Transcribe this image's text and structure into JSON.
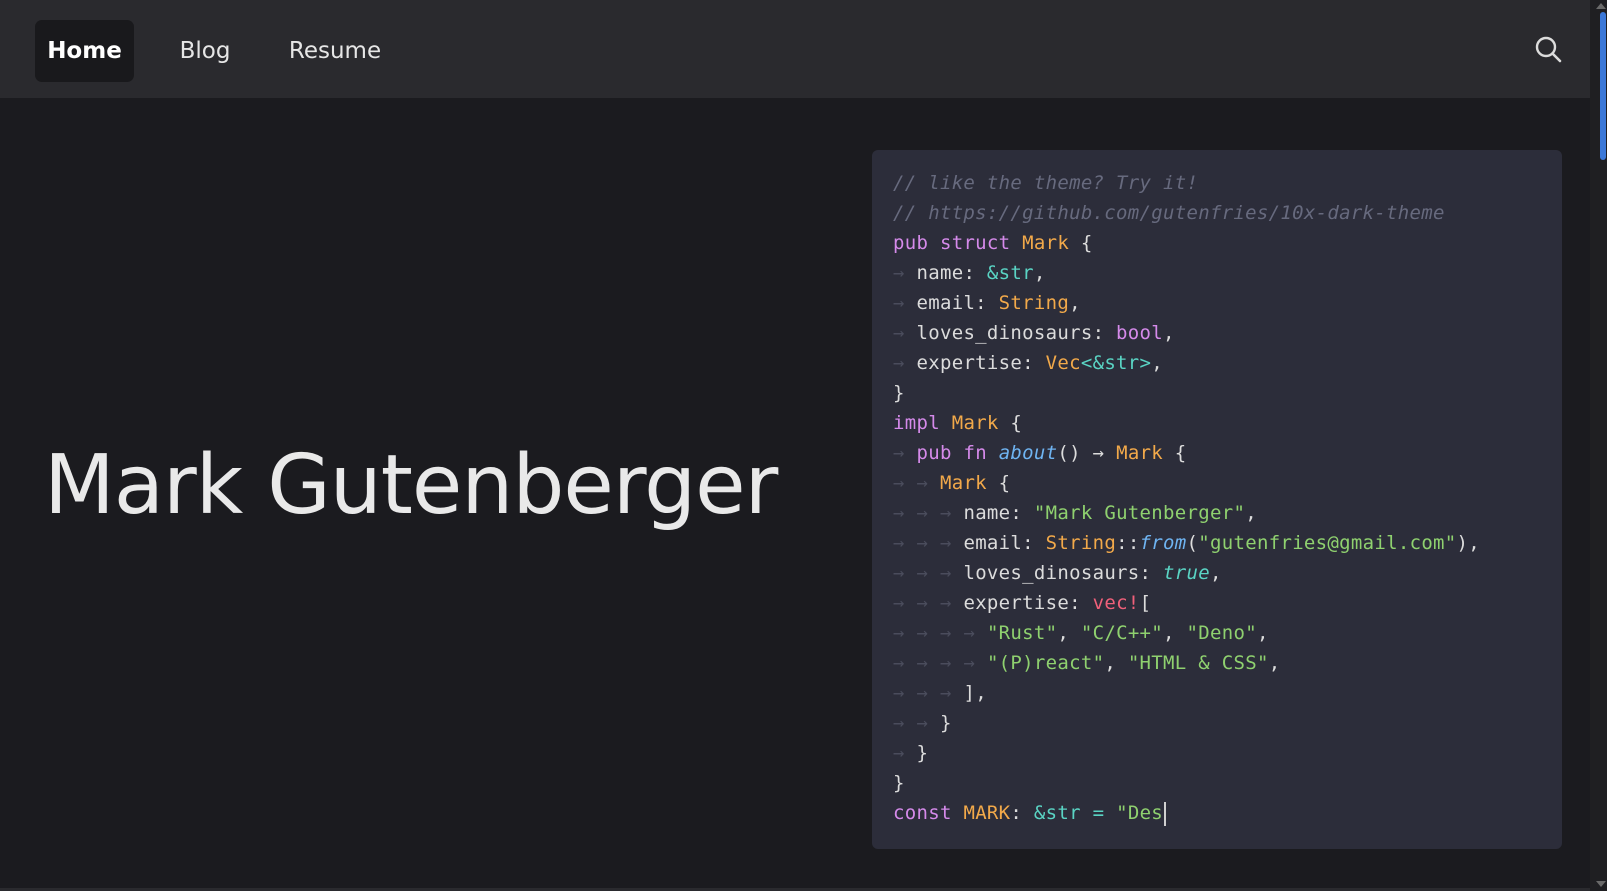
{
  "nav": {
    "items": [
      {
        "label": "Home",
        "active": true
      },
      {
        "label": "Blog",
        "active": false
      },
      {
        "label": "Resume",
        "active": false
      }
    ],
    "search_icon": "search-icon"
  },
  "hero": {
    "name": "Mark Gutenberger"
  },
  "code": {
    "lines": [
      {
        "indent": 0,
        "tokens": [
          {
            "t": "// like the theme? Try it!",
            "c": "comment"
          }
        ]
      },
      {
        "indent": 0,
        "tokens": [
          {
            "t": "// https://github.com/gutenfries/10x-dark-theme",
            "c": "comment"
          }
        ]
      },
      {
        "indent": 0,
        "tokens": [
          {
            "t": "pub",
            "c": "kw"
          },
          {
            "t": " ",
            "c": "plain"
          },
          {
            "t": "struct",
            "c": "kw"
          },
          {
            "t": " ",
            "c": "plain"
          },
          {
            "t": "Mark",
            "c": "type"
          },
          {
            "t": " {",
            "c": "plain"
          }
        ]
      },
      {
        "indent": 1,
        "tokens": [
          {
            "t": "name: ",
            "c": "plain"
          },
          {
            "t": "&str",
            "c": "ref"
          },
          {
            "t": ",",
            "c": "plain"
          }
        ]
      },
      {
        "indent": 1,
        "tokens": [
          {
            "t": "email: ",
            "c": "plain"
          },
          {
            "t": "String",
            "c": "type"
          },
          {
            "t": ",",
            "c": "plain"
          }
        ]
      },
      {
        "indent": 1,
        "tokens": [
          {
            "t": "loves_dinosaurs: ",
            "c": "plain"
          },
          {
            "t": "bool",
            "c": "kw"
          },
          {
            "t": ",",
            "c": "plain"
          }
        ]
      },
      {
        "indent": 1,
        "tokens": [
          {
            "t": "expertise: ",
            "c": "plain"
          },
          {
            "t": "Vec",
            "c": "type"
          },
          {
            "t": "<&str>",
            "c": "ref"
          },
          {
            "t": ",",
            "c": "plain"
          }
        ]
      },
      {
        "indent": 0,
        "tokens": [
          {
            "t": "}",
            "c": "plain"
          }
        ]
      },
      {
        "indent": 0,
        "tokens": [
          {
            "t": "impl",
            "c": "kw"
          },
          {
            "t": " ",
            "c": "plain"
          },
          {
            "t": "Mark",
            "c": "type"
          },
          {
            "t": " {",
            "c": "plain"
          }
        ]
      },
      {
        "indent": 1,
        "tokens": [
          {
            "t": "pub",
            "c": "kw"
          },
          {
            "t": " ",
            "c": "plain"
          },
          {
            "t": "fn",
            "c": "kw"
          },
          {
            "t": " ",
            "c": "plain"
          },
          {
            "t": "about",
            "c": "fn"
          },
          {
            "t": "() → ",
            "c": "plain"
          },
          {
            "t": "Mark",
            "c": "type"
          },
          {
            "t": " {",
            "c": "plain"
          }
        ]
      },
      {
        "indent": 2,
        "tokens": [
          {
            "t": "Mark",
            "c": "type"
          },
          {
            "t": " {",
            "c": "plain"
          }
        ]
      },
      {
        "indent": 3,
        "tokens": [
          {
            "t": "name: ",
            "c": "plain"
          },
          {
            "t": "\"Mark Gutenberger\"",
            "c": "str"
          },
          {
            "t": ",",
            "c": "plain"
          }
        ]
      },
      {
        "indent": 3,
        "tokens": [
          {
            "t": "email: ",
            "c": "plain"
          },
          {
            "t": "String",
            "c": "type"
          },
          {
            "t": "::",
            "c": "plain"
          },
          {
            "t": "from",
            "c": "fn"
          },
          {
            "t": "(",
            "c": "plain"
          },
          {
            "t": "\"gutenfries@gmail.com\"",
            "c": "str"
          },
          {
            "t": "),",
            "c": "plain"
          }
        ]
      },
      {
        "indent": 3,
        "tokens": [
          {
            "t": "loves_dinosaurs: ",
            "c": "plain"
          },
          {
            "t": "true",
            "c": "bool"
          },
          {
            "t": ",",
            "c": "plain"
          }
        ]
      },
      {
        "indent": 3,
        "tokens": [
          {
            "t": "expertise: ",
            "c": "plain"
          },
          {
            "t": "vec!",
            "c": "macro"
          },
          {
            "t": "[",
            "c": "plain"
          }
        ]
      },
      {
        "indent": 4,
        "tokens": [
          {
            "t": "\"Rust\"",
            "c": "str"
          },
          {
            "t": ", ",
            "c": "plain"
          },
          {
            "t": "\"C/C++\"",
            "c": "str"
          },
          {
            "t": ", ",
            "c": "plain"
          },
          {
            "t": "\"Deno\"",
            "c": "str"
          },
          {
            "t": ",",
            "c": "plain"
          }
        ]
      },
      {
        "indent": 4,
        "tokens": [
          {
            "t": "\"(P)react\"",
            "c": "str"
          },
          {
            "t": ", ",
            "c": "plain"
          },
          {
            "t": "\"HTML & CSS\"",
            "c": "str"
          },
          {
            "t": ",",
            "c": "plain"
          }
        ]
      },
      {
        "indent": 3,
        "tokens": [
          {
            "t": "],",
            "c": "plain"
          }
        ]
      },
      {
        "indent": 2,
        "tokens": [
          {
            "t": "}",
            "c": "plain"
          }
        ]
      },
      {
        "indent": 1,
        "tokens": [
          {
            "t": "}",
            "c": "plain"
          }
        ]
      },
      {
        "indent": 0,
        "tokens": [
          {
            "t": "}",
            "c": "plain"
          }
        ]
      },
      {
        "indent": 0,
        "tokens": [
          {
            "t": "const",
            "c": "kw"
          },
          {
            "t": " ",
            "c": "plain"
          },
          {
            "t": "MARK",
            "c": "type"
          },
          {
            "t": ": ",
            "c": "plain"
          },
          {
            "t": "&str",
            "c": "ref"
          },
          {
            "t": " = ",
            "c": "ref"
          },
          {
            "t": "\"Des",
            "c": "str"
          }
        ],
        "cursor": true
      }
    ]
  },
  "colors": {
    "background": "#1b1b1f",
    "navbar": "#2a2a2e",
    "code_panel": "#2c2d3a",
    "scrollbar_thumb": "#3b78d8"
  }
}
